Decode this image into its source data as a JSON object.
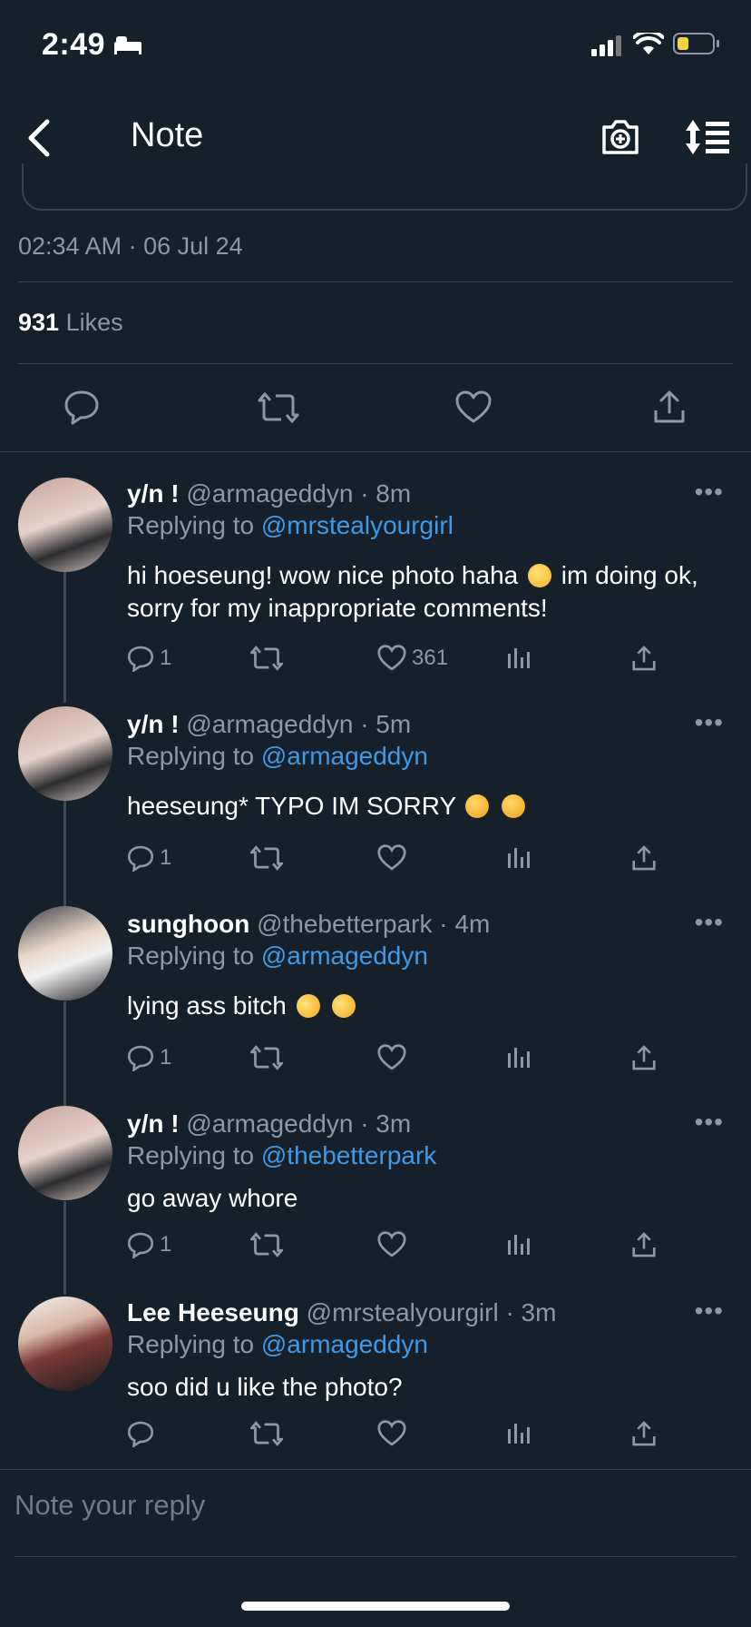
{
  "status_bar": {
    "time": "2:49"
  },
  "nav": {
    "title": "Note"
  },
  "tweet": {
    "timestamp": "02:34 AM · 06 Jul 24",
    "likes_count": "931",
    "likes_label": "Likes"
  },
  "replies": [
    {
      "name": "y/n !",
      "handle": "@armageddyn · 8m",
      "replying_prefix": "Replying to",
      "replying_to": "@mrstealyourgirl",
      "text_before": "hi hoeseung! wow nice photo haha",
      "text_after": " im doing ok, sorry for my inappropriate comments!",
      "reply_count": "1",
      "like_count": "361",
      "more": "•••"
    },
    {
      "name": "y/n !",
      "handle": "@armageddyn · 5m",
      "replying_prefix": "Replying to",
      "replying_to": "@armageddyn",
      "text_before": "heeseung* TYPO IM SORRY",
      "text_after": "",
      "reply_count": "1",
      "like_count": "",
      "more": "•••"
    },
    {
      "name": "sunghoon",
      "handle": "@thebetterpark · 4m",
      "replying_prefix": "Replying to",
      "replying_to": "@armageddyn",
      "text_before": "lying ass bitch",
      "text_after": "",
      "reply_count": "1",
      "like_count": "",
      "more": "•••"
    },
    {
      "name": "y/n !",
      "handle": "@armageddyn · 3m",
      "replying_prefix": "Replying to",
      "replying_to": "@thebetterpark",
      "text_before": "go away whore",
      "text_after": "",
      "reply_count": "1",
      "like_count": "",
      "more": "•••"
    },
    {
      "name": "Lee Heeseung",
      "handle": "@mrstealyourgirl · 3m",
      "replying_prefix": "Replying to",
      "replying_to": "@armageddyn",
      "text_before": "soo did u like the photo?",
      "text_after": "",
      "reply_count": "",
      "like_count": "",
      "more": "•••"
    }
  ],
  "composer": {
    "placeholder": "Note your reply"
  },
  "colors": {
    "background": "#15202b",
    "link": "#3f9ae6",
    "muted": "#8b98a5",
    "divider": "#38444d",
    "battery": "#f4d33d"
  }
}
